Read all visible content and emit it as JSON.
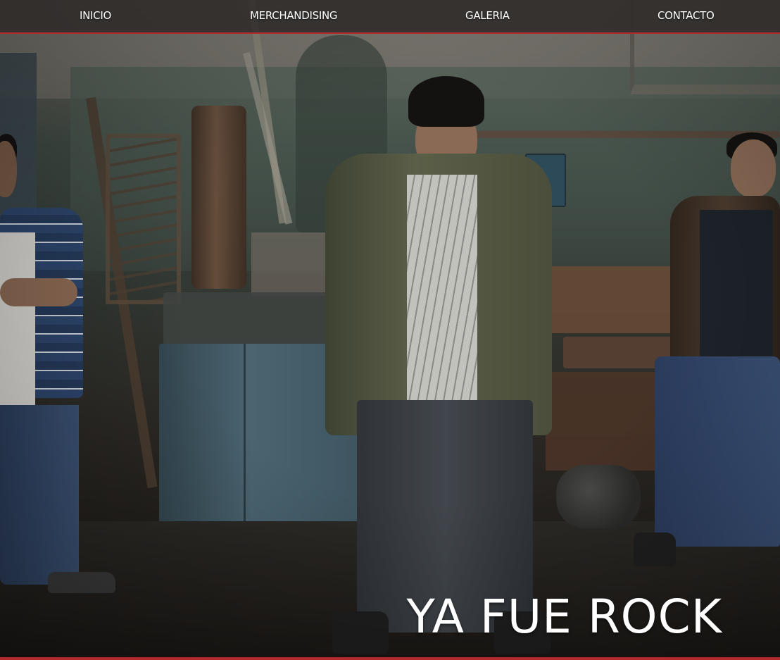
{
  "nav": {
    "items": [
      {
        "label": "INICIO"
      },
      {
        "label": "MERCHANDISING"
      },
      {
        "label": "GALERIA"
      },
      {
        "label": "CONTACTO"
      }
    ]
  },
  "hero": {
    "title": "YA FUE ROCK"
  },
  "colors": {
    "accent": "#b2282b",
    "nav_bg": "#2d2a28",
    "text": "#ffffff"
  }
}
